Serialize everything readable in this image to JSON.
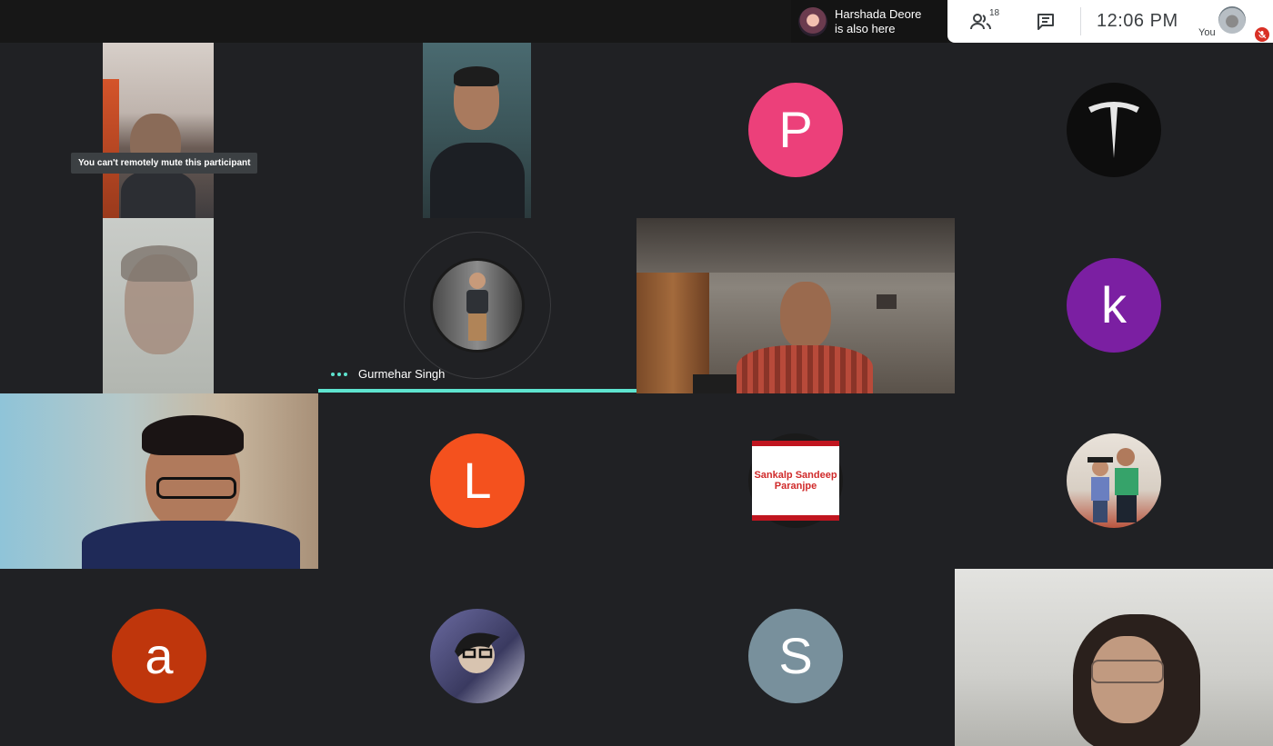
{
  "topbar": {
    "presence": {
      "line1": "Harshada Deore",
      "line2": "is also here"
    },
    "participant_count": "18",
    "clock": "12:06  PM",
    "self_label": "You"
  },
  "tiles": {
    "tooltip": "You can't remotely mute this participant",
    "gurmehar_name": "Gurmehar Singh",
    "avatar_p": "P",
    "avatar_k": "k",
    "avatar_l": "L",
    "avatar_a": "a",
    "avatar_s": "S",
    "sankalp_sign": "Sankalp Sandeep Paranjpe"
  },
  "colors": {
    "background": "#202124",
    "accent": "#5ee4cf",
    "avatar_p": "#ec407a",
    "avatar_k": "#7b1fa2",
    "avatar_l": "#f4511e",
    "avatar_a": "#bf360c",
    "avatar_s": "#78909c"
  }
}
